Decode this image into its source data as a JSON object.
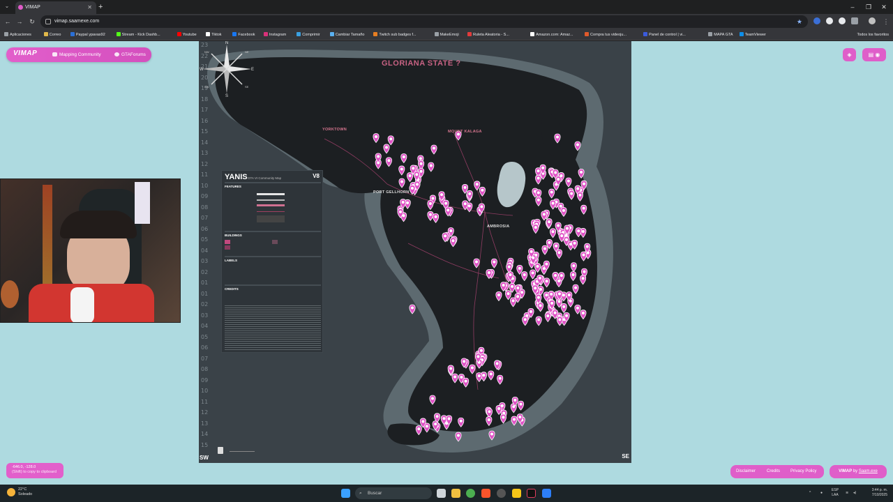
{
  "browser": {
    "tab_title": "VIMAP",
    "url": "vimap.saamexe.com",
    "bookmarks": [
      {
        "label": "Aplicaciones",
        "color": "#9aa0a6"
      },
      {
        "label": "Correo",
        "color": "#e0b84a"
      },
      {
        "label": "Paypal ypavas92",
        "color": "#2a6fd6"
      },
      {
        "label": "Stream - Kick Dashb...",
        "color": "#53fc18"
      },
      {
        "label": "Youtube",
        "color": "#ff0000"
      },
      {
        "label": "Tiktok",
        "color": "#ffffff"
      },
      {
        "label": "Facebook",
        "color": "#1877f2"
      },
      {
        "label": "Instagram",
        "color": "#d9317a"
      },
      {
        "label": "Comprimir",
        "color": "#3aa0e0"
      },
      {
        "label": "Cambiar Tamaño",
        "color": "#5ab0f0"
      },
      {
        "label": "Twitch sub badges f...",
        "color": "#e67e22"
      },
      {
        "label": "MakeEmoji",
        "color": "#9aa0a6"
      },
      {
        "label": "Ruleta Aleatoria - S...",
        "color": "#e23b3b"
      },
      {
        "label": "Amazon.com: Amaz...",
        "color": "#ffffff"
      },
      {
        "label": "Compra tus videoju...",
        "color": "#e05a2b"
      },
      {
        "label": "Panel de control | vi...",
        "color": "#3b5bdb"
      },
      {
        "label": "MAPA GTA",
        "color": "#9aa0a6"
      },
      {
        "label": "TeamViewer",
        "color": "#0e8ee9"
      }
    ],
    "all_bookmarks": "Todos los favoritos"
  },
  "app": {
    "logo": "VIMAP",
    "nav_mapping": "Mapping Community",
    "nav_forums": "GTAForums"
  },
  "map": {
    "title": "GLORIANA STATE ?",
    "labels": {
      "yorktown": "YORKTOWN",
      "mount_kalaga": "MOUNT KALAGA",
      "port_gellhorn": "PORT GELLHORN",
      "ambrosia": "AMBROSIA"
    },
    "corner_sw": "SW",
    "corner_se": "SE",
    "grid_numbers": [
      "23",
      "22",
      "21",
      "20",
      "19",
      "18",
      "17",
      "16",
      "15",
      "14",
      "13",
      "12",
      "11",
      "10",
      "09",
      "08",
      "07",
      "06",
      "05",
      "04",
      "03",
      "02",
      "01",
      "01",
      "02",
      "03",
      "04",
      "05",
      "06",
      "07",
      "08",
      "09",
      "10",
      "11",
      "12",
      "13",
      "14",
      "15"
    ],
    "legend": {
      "title": "YANIS",
      "subtitle": "GTA VI Community Map",
      "version": "V8",
      "features": "FEATURES",
      "buildings": "BUILDINGS",
      "labels": "LABELS",
      "credits": "CREDITS"
    },
    "compass": {
      "n": "N",
      "s": "S",
      "e": "E",
      "w": "W",
      "ne": "NE",
      "nw": "NW",
      "se": "SE",
      "sw": "SW"
    }
  },
  "coords": {
    "value": "-646.0, -128.0",
    "hint": "(Shift) to copy to clipboard"
  },
  "footer": {
    "disclaimer": "Disclaimer",
    "credits": "Credits",
    "privacy": "Privacy Policy",
    "by_prefix": "VIMAP",
    "by_mid": " by ",
    "by_author": "Saam.exe"
  },
  "taskbar": {
    "temp": "22°C",
    "weather": "Soleado",
    "search": "Buscar",
    "lang": "ESP",
    "lang2": "LAA",
    "time": "3:44 p. m.",
    "date": "7/10/2025"
  },
  "colors": {
    "accent": "#e25fcb",
    "page_bg": "#aedae0",
    "map_bg": "#3a4248",
    "marker": "#e052c6"
  }
}
